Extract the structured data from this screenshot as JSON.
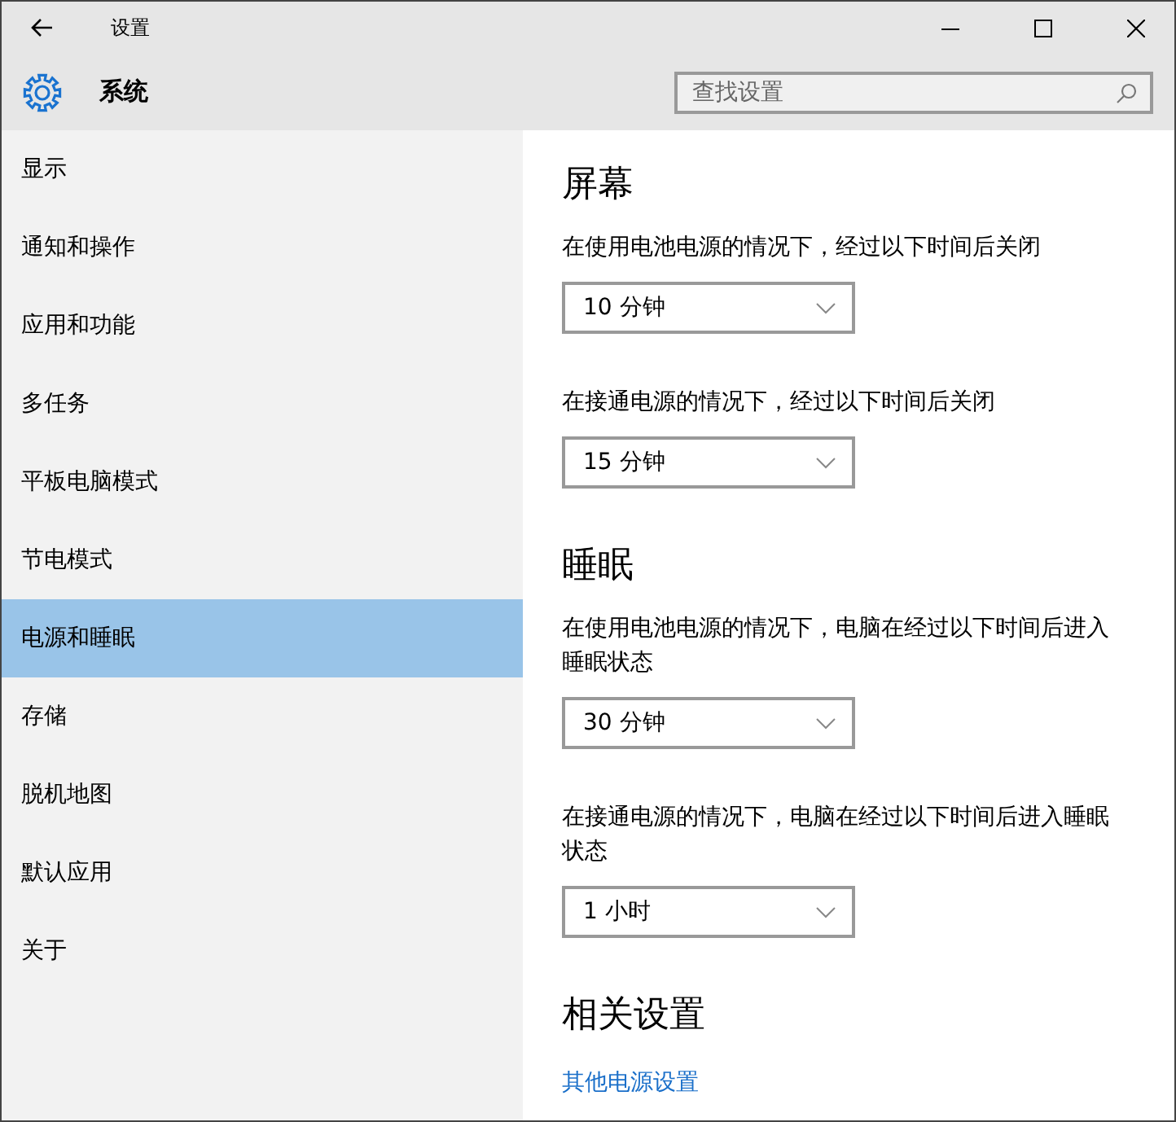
{
  "window": {
    "title": "设置"
  },
  "header": {
    "title": "系统",
    "search": {
      "placeholder": "查找设置"
    }
  },
  "sidebar": {
    "items": [
      {
        "label": "显示",
        "selected": false
      },
      {
        "label": "通知和操作",
        "selected": false
      },
      {
        "label": "应用和功能",
        "selected": false
      },
      {
        "label": "多任务",
        "selected": false
      },
      {
        "label": "平板电脑模式",
        "selected": false
      },
      {
        "label": "节电模式",
        "selected": false
      },
      {
        "label": "电源和睡眠",
        "selected": true
      },
      {
        "label": "存储",
        "selected": false
      },
      {
        "label": "脱机地图",
        "selected": false
      },
      {
        "label": "默认应用",
        "selected": false
      },
      {
        "label": "关于",
        "selected": false
      }
    ]
  },
  "sections": [
    {
      "heading": "屏幕",
      "settings": [
        {
          "label": "在使用电池电源的情况下，经过以下时间后关闭",
          "value": "10 分钟"
        },
        {
          "label": "在接通电源的情况下，经过以下时间后关闭",
          "value": "15 分钟"
        }
      ]
    },
    {
      "heading": "睡眠",
      "settings": [
        {
          "label": "在使用电池电源的情况下，电脑在经过以下时间后进入睡眠状态",
          "value": "30 分钟"
        },
        {
          "label": "在接通电源的情况下，电脑在经过以下时间后进入睡眠状态",
          "value": "1 小时"
        }
      ]
    },
    {
      "heading": "相关设置",
      "links": [
        "其他电源设置"
      ]
    }
  ]
}
